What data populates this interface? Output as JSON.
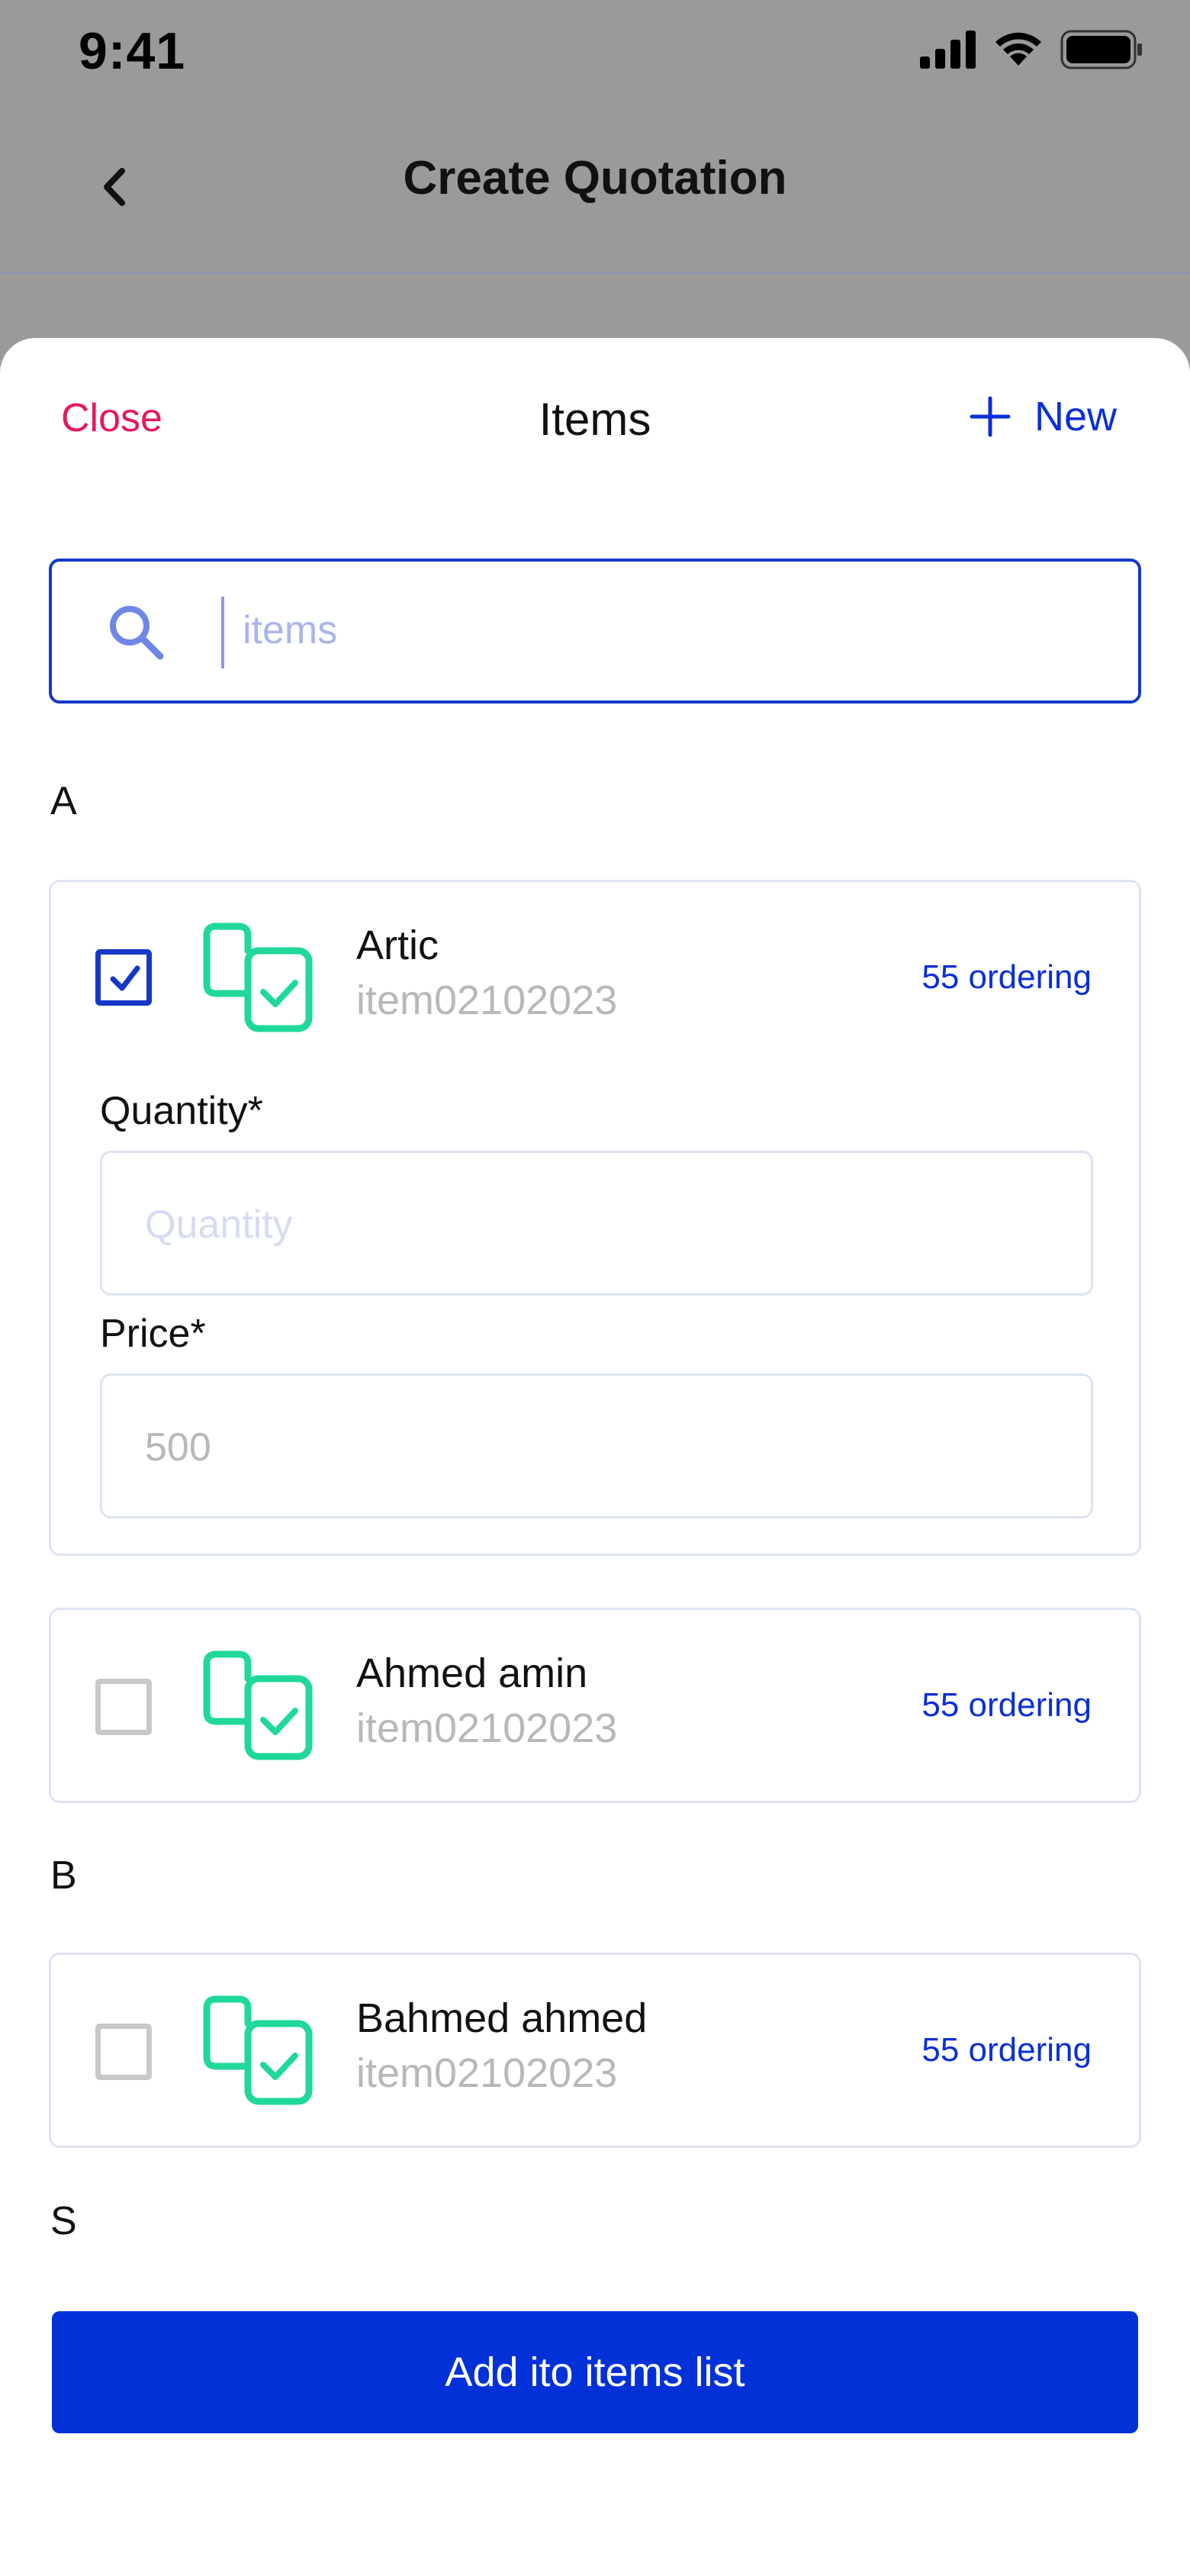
{
  "status_bar": {
    "time": "9:41"
  },
  "nav": {
    "title": "Create Quotation"
  },
  "sheet": {
    "close_label": "Close",
    "title": "Items",
    "new_label": "New",
    "search": {
      "placeholder": "items",
      "value": ""
    }
  },
  "sections": [
    {
      "letter": "A"
    },
    {
      "letter": "B"
    },
    {
      "letter": "S"
    }
  ],
  "items": [
    {
      "name": "Artic",
      "code": "item02102023",
      "ordering": "55 ordering",
      "checked": true,
      "quantity_label": "Quantity*",
      "quantity_placeholder": "Quantity",
      "quantity_value": "",
      "price_label": "Price*",
      "price_value": "500"
    },
    {
      "name": "Ahmed amin",
      "code": "item02102023",
      "ordering": "55 ordering",
      "checked": false
    },
    {
      "name": "Bahmed ahmed",
      "code": "item02102023",
      "ordering": "55 ordering",
      "checked": false
    }
  ],
  "add_button_label": "Add ito items list",
  "colors": {
    "accent": "#0231d8",
    "danger": "#e5195b",
    "item_icon": "#1fd89a",
    "overlay": "#9a9a9a"
  },
  "icons": [
    "signal-icon",
    "wifi-icon",
    "battery-icon",
    "back-icon",
    "plus-icon",
    "search-icon",
    "item-icon",
    "check-icon"
  ]
}
